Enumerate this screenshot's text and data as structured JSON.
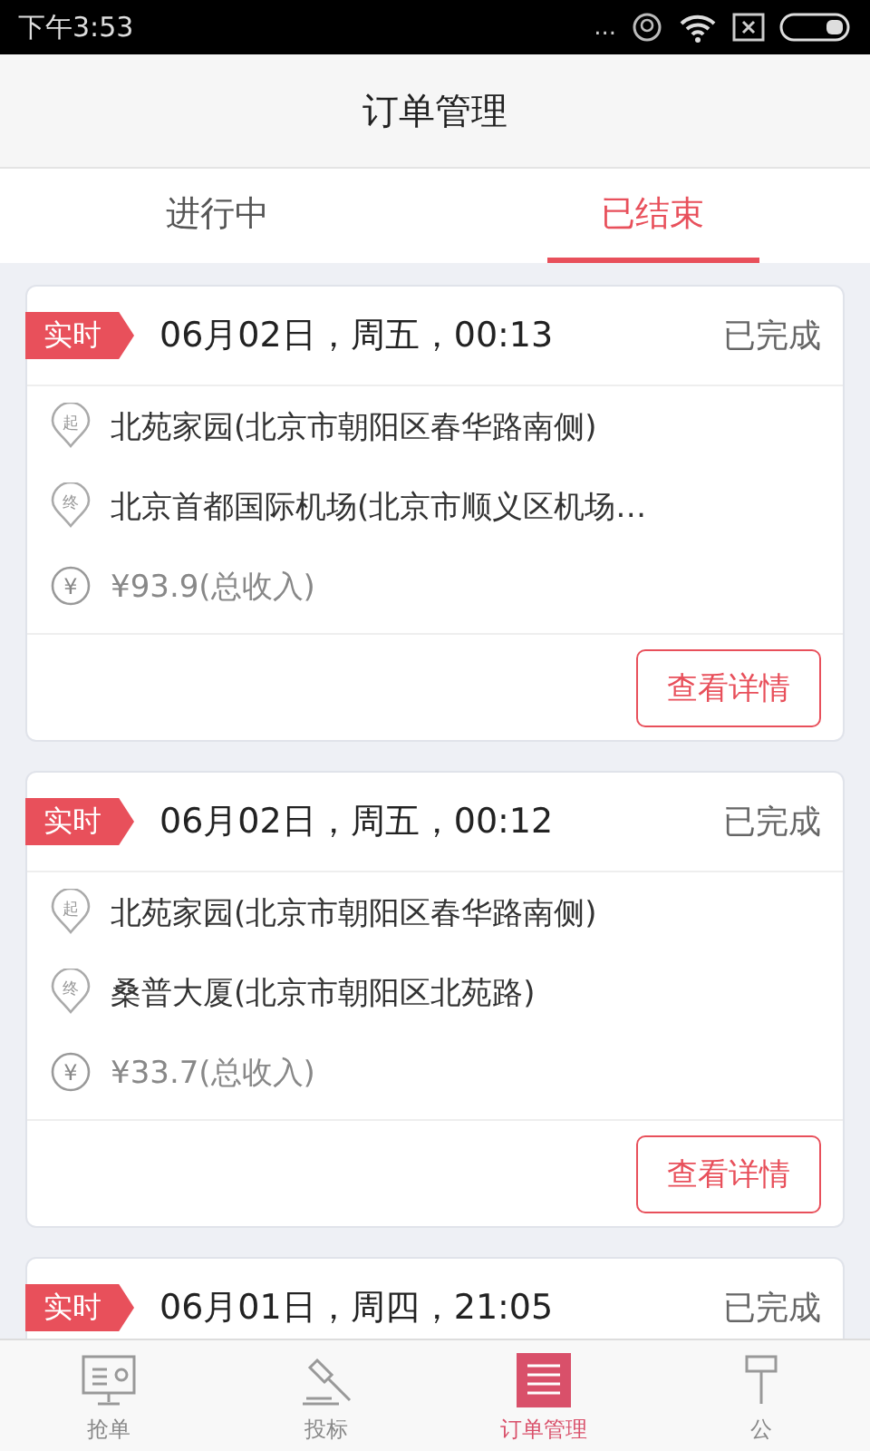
{
  "status_bar": {
    "time": "下午3:53",
    "dots": "..."
  },
  "header": {
    "title": "订单管理"
  },
  "tabs": [
    {
      "label": "进行中",
      "selected": false
    },
    {
      "label": "已结束",
      "selected": true
    }
  ],
  "orders": [
    {
      "tag": "实时",
      "datetime": "06月02日，周五，00:13",
      "status": "已完成",
      "start_marker": "起",
      "start": "北苑家园(北京市朝阳区春华路南侧)",
      "end_marker": "终",
      "end": "北京首都国际机场(北京市顺义区机场…",
      "currency_marker": "¥",
      "income": "¥93.9(总收入)",
      "button": "查看详情"
    },
    {
      "tag": "实时",
      "datetime": "06月02日，周五，00:12",
      "status": "已完成",
      "start_marker": "起",
      "start": "北苑家园(北京市朝阳区春华路南侧)",
      "end_marker": "终",
      "end": "桑普大厦(北京市朝阳区北苑路)",
      "currency_marker": "¥",
      "income": "¥33.7(总收入)",
      "button": "查看详情"
    },
    {
      "tag": "实时",
      "datetime": "06月01日，周四，21:05",
      "status": "已完成"
    }
  ],
  "bottom_nav": [
    {
      "label": "抢单",
      "kind": "monitor",
      "selected": false
    },
    {
      "label": "投标",
      "kind": "gavel",
      "selected": false
    },
    {
      "label": "订单管理",
      "kind": "list",
      "selected": true
    },
    {
      "label": "公",
      "kind": "pin",
      "selected": false
    }
  ]
}
